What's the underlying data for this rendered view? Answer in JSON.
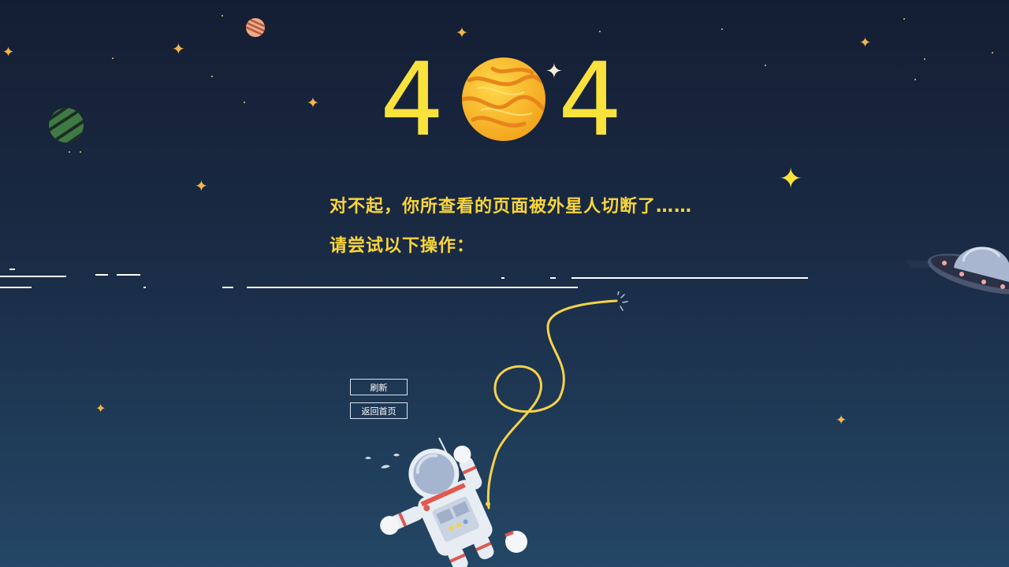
{
  "hero": {
    "digit_left": "4",
    "digit_right": "4"
  },
  "message": {
    "line1": "对不起，你所查看的页面被外星人切断了……",
    "line2": "请尝试以下操作："
  },
  "actions": {
    "refresh_label": "刷新",
    "home_label": "返回首页"
  },
  "colors": {
    "accent_yellow": "#f9e23b",
    "star_orange": "#f5b54a",
    "background_top": "#141e33",
    "background_bottom": "#234766"
  },
  "icons": [
    "planet-icon",
    "star-icon",
    "ufo-icon",
    "astronaut-illustration",
    "cable-icon"
  ]
}
